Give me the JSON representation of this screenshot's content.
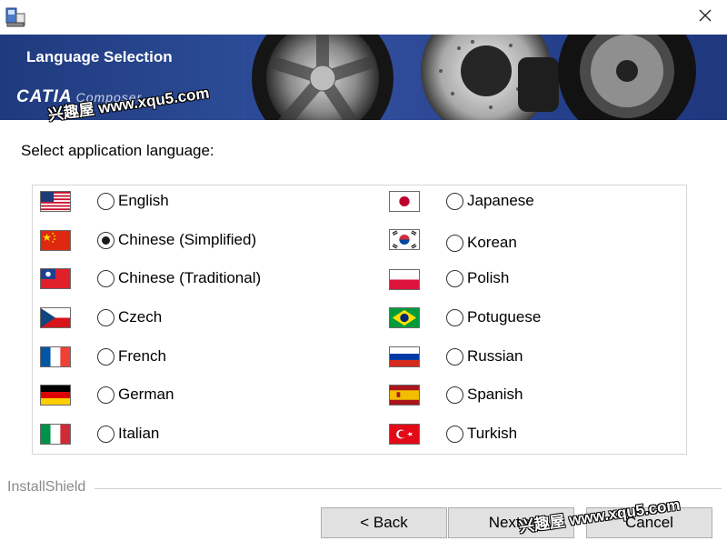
{
  "window": {
    "title": ""
  },
  "banner": {
    "title": "Language Selection",
    "logo_text": "CATIA",
    "logo_sub": "Composer",
    "watermark": "兴趣屋 www.xqu5.com"
  },
  "prompt": "Select application language:",
  "languages": {
    "left": [
      {
        "label": "English",
        "selected": false,
        "flag": "us-flag-icon"
      },
      {
        "label": "Chinese (Simplified)",
        "selected": true,
        "flag": "china-flag-icon"
      },
      {
        "label": "Chinese (Traditional)",
        "selected": false,
        "flag": "taiwan-flag-icon"
      },
      {
        "label": "Czech",
        "selected": false,
        "flag": "czech-flag-icon"
      },
      {
        "label": "French",
        "selected": false,
        "flag": "france-flag-icon"
      },
      {
        "label": "German",
        "selected": false,
        "flag": "germany-flag-icon"
      },
      {
        "label": "Italian",
        "selected": false,
        "flag": "italy-flag-icon"
      }
    ],
    "right": [
      {
        "label": "Japanese",
        "selected": false,
        "flag": "japan-flag-icon"
      },
      {
        "label": "Korean",
        "selected": false,
        "flag": "korea-flag-icon"
      },
      {
        "label": "Polish",
        "selected": false,
        "flag": "poland-flag-icon"
      },
      {
        "label": "Potuguese",
        "selected": false,
        "flag": "brazil-flag-icon"
      },
      {
        "label": "Russian",
        "selected": false,
        "flag": "russia-flag-icon"
      },
      {
        "label": "Spanish",
        "selected": false,
        "flag": "spain-flag-icon"
      },
      {
        "label": "Turkish",
        "selected": false,
        "flag": "turkey-flag-icon"
      }
    ]
  },
  "footer": {
    "brand": "InstallShield",
    "back_label": "< Back",
    "next_label": "Next >",
    "cancel_label": "Cancel",
    "watermark": "兴趣屋 www.xqu5.com"
  }
}
